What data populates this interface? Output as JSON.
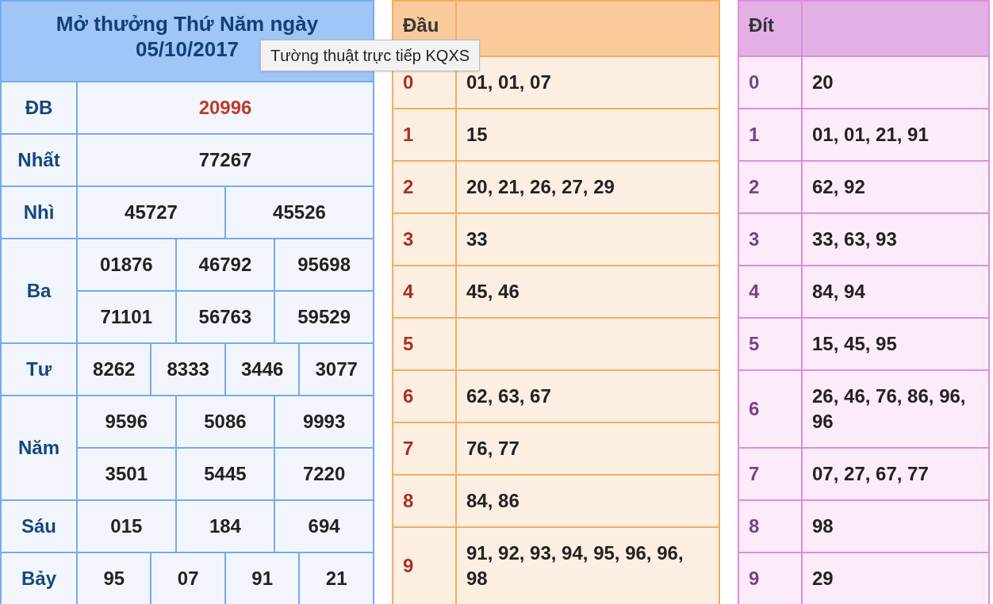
{
  "results": {
    "title": "Mở thưởng Thứ Năm ngày 05/10/2017",
    "prizes": [
      {
        "label": "ĐB",
        "kind": "special",
        "rows": [
          [
            "20996"
          ]
        ]
      },
      {
        "label": "Nhất",
        "kind": "normal",
        "rows": [
          [
            "77267"
          ]
        ]
      },
      {
        "label": "Nhì",
        "kind": "normal",
        "rows": [
          [
            "45727",
            "45526"
          ]
        ]
      },
      {
        "label": "Ba",
        "kind": "normal",
        "rows": [
          [
            "01876",
            "46792",
            "95698"
          ],
          [
            "71101",
            "56763",
            "59529"
          ]
        ]
      },
      {
        "label": "Tư",
        "kind": "normal",
        "rows": [
          [
            "8262",
            "8333",
            "3446",
            "3077"
          ]
        ]
      },
      {
        "label": "Năm",
        "kind": "normal",
        "rows": [
          [
            "9596",
            "5086",
            "9993"
          ],
          [
            "3501",
            "5445",
            "7220"
          ]
        ]
      },
      {
        "label": "Sáu",
        "kind": "normal",
        "rows": [
          [
            "015",
            "184",
            "694"
          ]
        ]
      },
      {
        "label": "Bảy",
        "kind": "normal",
        "rows": [
          [
            "95",
            "07",
            "91",
            "21"
          ]
        ]
      }
    ]
  },
  "tooltip": "Tường thuật trực tiếp KQXS",
  "head_table": {
    "heading": "Đầu",
    "rows": [
      {
        "digit": "0",
        "numbers": "01, 01, 07"
      },
      {
        "digit": "1",
        "numbers": "15"
      },
      {
        "digit": "2",
        "numbers": "20, 21, 26, 27, 29"
      },
      {
        "digit": "3",
        "numbers": "33"
      },
      {
        "digit": "4",
        "numbers": "45, 46"
      },
      {
        "digit": "5",
        "numbers": ""
      },
      {
        "digit": "6",
        "numbers": "62, 63, 67"
      },
      {
        "digit": "7",
        "numbers": "76, 77"
      },
      {
        "digit": "8",
        "numbers": "84, 86"
      },
      {
        "digit": "9",
        "numbers": "91, 92, 93, 94, 95, 96, 96, 98"
      }
    ]
  },
  "tail_table": {
    "heading": "Đít",
    "rows": [
      {
        "digit": "0",
        "numbers": "20"
      },
      {
        "digit": "1",
        "numbers": "01, 01, 21, 91"
      },
      {
        "digit": "2",
        "numbers": "62, 92"
      },
      {
        "digit": "3",
        "numbers": "33, 63, 93"
      },
      {
        "digit": "4",
        "numbers": "84, 94"
      },
      {
        "digit": "5",
        "numbers": "15, 45, 95"
      },
      {
        "digit": "6",
        "numbers": "26, 46, 76, 86, 96, 96"
      },
      {
        "digit": "7",
        "numbers": "07, 27, 67, 77"
      },
      {
        "digit": "8",
        "numbers": "98"
      },
      {
        "digit": "9",
        "numbers": "29"
      }
    ]
  }
}
